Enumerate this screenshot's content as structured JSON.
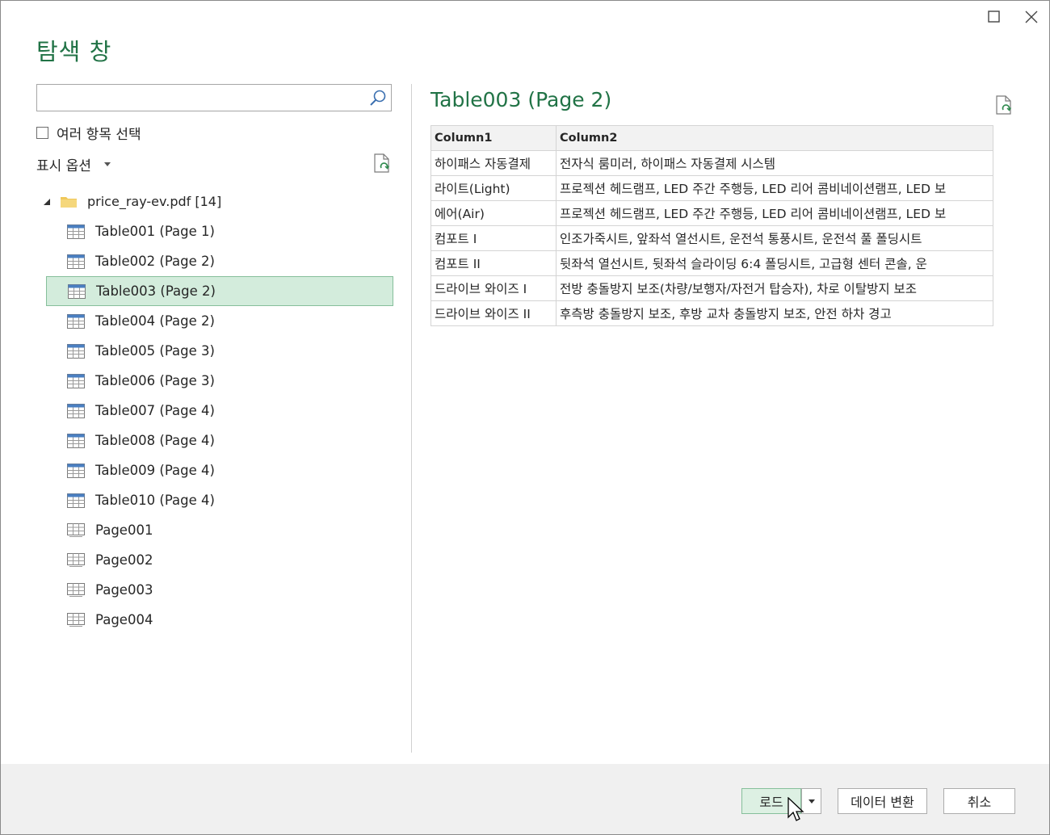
{
  "dialog": {
    "title": "탐색 창"
  },
  "search": {
    "value": "",
    "placeholder": ""
  },
  "multi_select": {
    "label": "여러 항목 선택",
    "checked": false
  },
  "display_options": {
    "label": "표시 옵션"
  },
  "tree": {
    "root_label": "price_ray-ev.pdf [14]",
    "items": [
      {
        "label": "Table001 (Page 1)",
        "icon": "table-icon",
        "selected": false
      },
      {
        "label": "Table002 (Page 2)",
        "icon": "table-icon",
        "selected": false
      },
      {
        "label": "Table003 (Page 2)",
        "icon": "table-icon",
        "selected": true
      },
      {
        "label": "Table004 (Page 2)",
        "icon": "table-icon",
        "selected": false
      },
      {
        "label": "Table005 (Page 3)",
        "icon": "table-icon",
        "selected": false
      },
      {
        "label": "Table006 (Page 3)",
        "icon": "table-icon",
        "selected": false
      },
      {
        "label": "Table007 (Page 4)",
        "icon": "table-icon",
        "selected": false
      },
      {
        "label": "Table008 (Page 4)",
        "icon": "table-icon",
        "selected": false
      },
      {
        "label": "Table009 (Page 4)",
        "icon": "table-icon",
        "selected": false
      },
      {
        "label": "Table010 (Page 4)",
        "icon": "table-icon",
        "selected": false
      },
      {
        "label": "Page001",
        "icon": "page-icon",
        "selected": false
      },
      {
        "label": "Page002",
        "icon": "page-icon",
        "selected": false
      },
      {
        "label": "Page003",
        "icon": "page-icon",
        "selected": false
      },
      {
        "label": "Page004",
        "icon": "page-icon",
        "selected": false
      }
    ]
  },
  "preview": {
    "title": "Table003 (Page 2)",
    "columns": [
      "Column1",
      "Column2"
    ],
    "rows": [
      [
        "하이패스 자동결제",
        "전자식 룸미러, 하이패스 자동결제 시스템"
      ],
      [
        "라이트(Light)",
        "프로젝션 헤드램프, LED 주간 주행등, LED 리어 콤비네이션램프, LED 보"
      ],
      [
        "에어(Air)",
        "프로젝션 헤드램프, LED 주간 주행등, LED 리어 콤비네이션램프, LED 보"
      ],
      [
        "컴포트 I",
        "인조가죽시트, 앞좌석 열선시트, 운전석 통풍시트, 운전석 풀 폴딩시트"
      ],
      [
        "컴포트 II",
        "뒷좌석 열선시트, 뒷좌석 슬라이딩 6:4 폴딩시트, 고급형 센터 콘솔, 운"
      ],
      [
        "드라이브 와이즈 I",
        "전방 충돌방지 보조(차량/보행자/자전거 탑승자), 차로 이탈방지 보조"
      ],
      [
        "드라이브 와이즈 II",
        "후측방 충돌방지 보조, 후방 교차 충돌방지 보조, 안전 하차 경고"
      ]
    ]
  },
  "footer": {
    "load_label": "로드",
    "transform_label": "데이터 변환",
    "cancel_label": "취소"
  },
  "colors": {
    "accent": "#217346",
    "selected_bg": "#d3ecdc",
    "selected_border": "#86bf9b",
    "footer_bg": "#f0f0f0"
  }
}
